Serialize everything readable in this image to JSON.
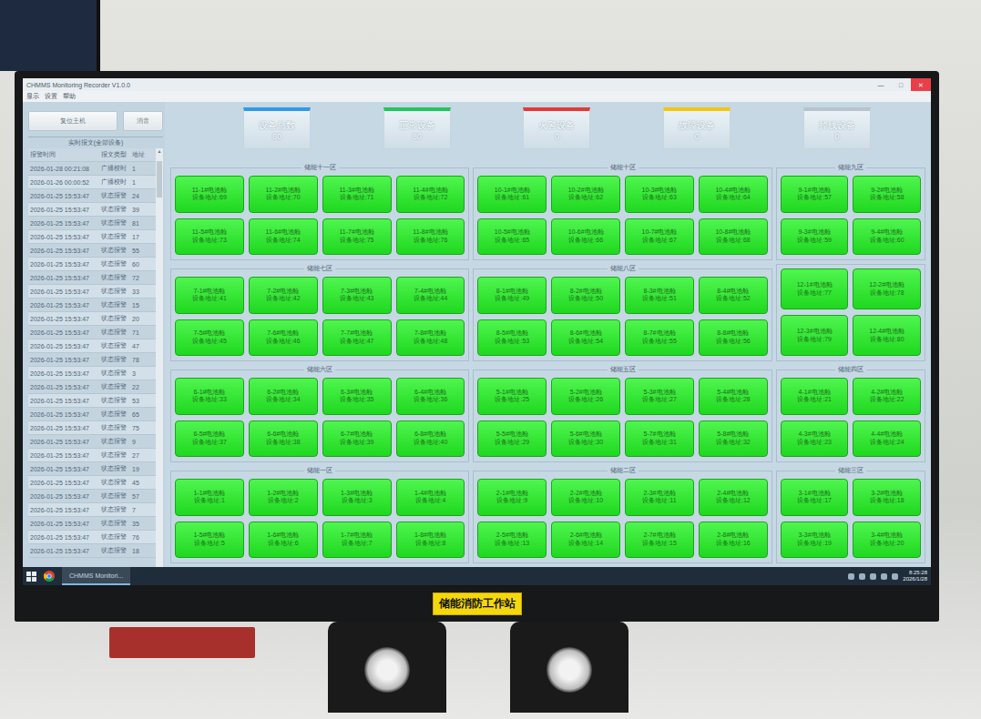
{
  "window": {
    "title": "CHMMS Monitoring Recorder V1.0.0",
    "controls": [
      "—",
      "□",
      "✕"
    ]
  },
  "menu": [
    "显示",
    "设置",
    "帮助"
  ],
  "buttons": [
    "复位主机",
    "消音"
  ],
  "log": {
    "title": "实时报文(全部设备)",
    "columns": [
      "报警时间",
      "报文类型",
      "地址"
    ],
    "rows": [
      [
        "2026-01-28 00:21:08",
        "广播校时",
        "1"
      ],
      [
        "2026-01-26 00:00:52",
        "广播校时",
        "1"
      ],
      [
        "2026-01-25 15:53:47",
        "状态报警",
        "24"
      ],
      [
        "2026-01-25 15:53:47",
        "状态报警",
        "39"
      ],
      [
        "2026-01-25 15:53:47",
        "状态报警",
        "81"
      ],
      [
        "2026-01-25 15:53:47",
        "状态报警",
        "17"
      ],
      [
        "2026-01-25 15:53:47",
        "状态报警",
        "55"
      ],
      [
        "2026-01-25 15:53:47",
        "状态报警",
        "60"
      ],
      [
        "2026-01-25 15:53:47",
        "状态报警",
        "72"
      ],
      [
        "2026-01-25 15:53:47",
        "状态报警",
        "33"
      ],
      [
        "2026-01-25 15:53:47",
        "状态报警",
        "15"
      ],
      [
        "2026-01-25 15:53:47",
        "状态报警",
        "20"
      ],
      [
        "2026-01-25 15:53:47",
        "状态报警",
        "71"
      ],
      [
        "2026-01-25 15:53:47",
        "状态报警",
        "47"
      ],
      [
        "2026-01-25 15:53:47",
        "状态报警",
        "78"
      ],
      [
        "2026-01-25 15:53:47",
        "状态报警",
        "3"
      ],
      [
        "2026-01-25 15:53:47",
        "状态报警",
        "22"
      ],
      [
        "2026-01-25 15:53:47",
        "状态报警",
        "53"
      ],
      [
        "2026-01-25 15:53:47",
        "状态报警",
        "65"
      ],
      [
        "2026-01-25 15:53:47",
        "状态报警",
        "75"
      ],
      [
        "2026-01-25 15:53:47",
        "状态报警",
        "9"
      ],
      [
        "2026-01-25 15:53:47",
        "状态报警",
        "27"
      ],
      [
        "2026-01-25 15:53:47",
        "状态报警",
        "19"
      ],
      [
        "2026-01-25 15:53:47",
        "状态报警",
        "45"
      ],
      [
        "2026-01-25 15:53:47",
        "状态报警",
        "57"
      ],
      [
        "2026-01-25 15:53:47",
        "状态报警",
        "7"
      ],
      [
        "2026-01-25 15:53:47",
        "状态报警",
        "35"
      ],
      [
        "2026-01-25 15:53:47",
        "状态报警",
        "76"
      ],
      [
        "2026-01-25 15:53:47",
        "状态报警",
        "18"
      ]
    ]
  },
  "stats": [
    {
      "label": "设备总数",
      "value": "80",
      "color": "#2f9be6"
    },
    {
      "label": "正常设备",
      "value": "80",
      "color": "#22c55e"
    },
    {
      "label": "火警设备",
      "value": "0",
      "color": "#e53935"
    },
    {
      "label": "故障设备",
      "value": "0",
      "color": "#f2c80f"
    },
    {
      "label": "掉线设备",
      "value": "0",
      "color": "#b9c3cc"
    }
  ],
  "zones": [
    {
      "label": "储能十一区",
      "cards": [
        {
          "name": "11-1#电池舱",
          "address": "设备地址:69",
          "status": "normal"
        },
        {
          "name": "11-2#电池舱",
          "address": "设备地址:70",
          "status": "normal"
        },
        {
          "name": "11-3#电池舱",
          "address": "设备地址:71",
          "status": "normal"
        },
        {
          "name": "11-4#电池舱",
          "address": "设备地址:72",
          "status": "normal"
        },
        {
          "name": "11-5#电池舱",
          "address": "设备地址:73",
          "status": "normal"
        },
        {
          "name": "11-6#电池舱",
          "address": "设备地址:74",
          "status": "normal"
        },
        {
          "name": "11-7#电池舱",
          "address": "设备地址:75",
          "status": "normal"
        },
        {
          "name": "11-8#电池舱",
          "address": "设备地址:76",
          "status": "normal"
        }
      ]
    },
    {
      "label": "储能十区",
      "cards": [
        {
          "name": "10-1#电池舱",
          "address": "设备地址:61",
          "status": "normal"
        },
        {
          "name": "10-2#电池舱",
          "address": "设备地址:62",
          "status": "normal"
        },
        {
          "name": "10-3#电池舱",
          "address": "设备地址:63",
          "status": "normal"
        },
        {
          "name": "10-4#电池舱",
          "address": "设备地址:64",
          "status": "normal"
        },
        {
          "name": "10-5#电池舱",
          "address": "设备地址:65",
          "status": "normal"
        },
        {
          "name": "10-6#电池舱",
          "address": "设备地址:66",
          "status": "normal"
        },
        {
          "name": "10-7#电池舱",
          "address": "设备地址:67",
          "status": "normal"
        },
        {
          "name": "10-8#电池舱",
          "address": "设备地址:68",
          "status": "normal"
        }
      ]
    },
    {
      "label": "储能九区",
      "cards": [
        {
          "name": "9-1#电池舱",
          "address": "设备地址:57",
          "status": "normal"
        },
        {
          "name": "9-2#电池舱",
          "address": "设备地址:58",
          "status": "normal"
        },
        {
          "name": "9-3#电池舱",
          "address": "设备地址:59",
          "status": "normal"
        },
        {
          "name": "9-4#电池舱",
          "address": "设备地址:60",
          "status": "normal"
        }
      ]
    },
    {
      "label": "储能七区",
      "cards": [
        {
          "name": "7-1#电池舱",
          "address": "设备地址:41",
          "status": "normal"
        },
        {
          "name": "7-2#电池舱",
          "address": "设备地址:42",
          "status": "normal"
        },
        {
          "name": "7-3#电池舱",
          "address": "设备地址:43",
          "status": "normal"
        },
        {
          "name": "7-4#电池舱",
          "address": "设备地址:44",
          "status": "normal"
        },
        {
          "name": "7-5#电池舱",
          "address": "设备地址:45",
          "status": "normal"
        },
        {
          "name": "7-6#电池舱",
          "address": "设备地址:46",
          "status": "normal"
        },
        {
          "name": "7-7#电池舱",
          "address": "设备地址:47",
          "status": "normal"
        },
        {
          "name": "7-8#电池舱",
          "address": "设备地址:48",
          "status": "normal"
        }
      ]
    },
    {
      "label": "储能八区",
      "cards": [
        {
          "name": "8-1#电池舱",
          "address": "设备地址:49",
          "status": "normal"
        },
        {
          "name": "8-2#电池舱",
          "address": "设备地址:50",
          "status": "normal"
        },
        {
          "name": "8-3#电池舱",
          "address": "设备地址:51",
          "status": "normal"
        },
        {
          "name": "8-4#电池舱",
          "address": "设备地址:52",
          "status": "normal"
        },
        {
          "name": "8-5#电池舱",
          "address": "设备地址:53",
          "status": "normal"
        },
        {
          "name": "8-6#电池舱",
          "address": "设备地址:54",
          "status": "normal"
        },
        {
          "name": "8-7#电池舱",
          "address": "设备地址:55",
          "status": "normal"
        },
        {
          "name": "8-8#电池舱",
          "address": "设备地址:56",
          "status": "normal"
        }
      ]
    },
    {
      "label": "",
      "cards": [
        {
          "name": "12-1#电池舱",
          "address": "设备地址:77",
          "status": "normal"
        },
        {
          "name": "12-2#电池舱",
          "address": "设备地址:78",
          "status": "normal"
        },
        {
          "name": "12-3#电池舱",
          "address": "设备地址:79",
          "status": "normal"
        },
        {
          "name": "12-4#电池舱",
          "address": "设备地址:80",
          "status": "normal"
        }
      ]
    },
    {
      "label": "储能六区",
      "cards": [
        {
          "name": "6-1#电池舱",
          "address": "设备地址:33",
          "status": "normal"
        },
        {
          "name": "6-2#电池舱",
          "address": "设备地址:34",
          "status": "normal"
        },
        {
          "name": "6-3#电池舱",
          "address": "设备地址:35",
          "status": "normal"
        },
        {
          "name": "6-4#电池舱",
          "address": "设备地址:36",
          "status": "normal"
        },
        {
          "name": "6-5#电池舱",
          "address": "设备地址:37",
          "status": "normal"
        },
        {
          "name": "6-6#电池舱",
          "address": "设备地址:38",
          "status": "normal"
        },
        {
          "name": "6-7#电池舱",
          "address": "设备地址:39",
          "status": "normal"
        },
        {
          "name": "6-8#电池舱",
          "address": "设备地址:40",
          "status": "normal"
        }
      ]
    },
    {
      "label": "储能五区",
      "cards": [
        {
          "name": "5-1#电池舱",
          "address": "设备地址:25",
          "status": "normal"
        },
        {
          "name": "5-2#电池舱",
          "address": "设备地址:26",
          "status": "normal"
        },
        {
          "name": "5-3#电池舱",
          "address": "设备地址:27",
          "status": "normal"
        },
        {
          "name": "5-4#电池舱",
          "address": "设备地址:28",
          "status": "normal"
        },
        {
          "name": "5-5#电池舱",
          "address": "设备地址:29",
          "status": "normal"
        },
        {
          "name": "5-6#电池舱",
          "address": "设备地址:30",
          "status": "normal"
        },
        {
          "name": "5-7#电池舱",
          "address": "设备地址:31",
          "status": "normal"
        },
        {
          "name": "5-8#电池舱",
          "address": "设备地址:32",
          "status": "normal"
        }
      ]
    },
    {
      "label": "储能四区",
      "cards": [
        {
          "name": "4-1#电池舱",
          "address": "设备地址:21",
          "status": "normal"
        },
        {
          "name": "4-2#电池舱",
          "address": "设备地址:22",
          "status": "normal"
        },
        {
          "name": "4-3#电池舱",
          "address": "设备地址:23",
          "status": "normal"
        },
        {
          "name": "4-4#电池舱",
          "address": "设备地址:24",
          "status": "normal"
        }
      ]
    },
    {
      "label": "储能一区",
      "cards": [
        {
          "name": "1-1#电池舱",
          "address": "设备地址:1",
          "status": "normal"
        },
        {
          "name": "1-2#电池舱",
          "address": "设备地址:2",
          "status": "normal"
        },
        {
          "name": "1-3#电池舱",
          "address": "设备地址:3",
          "status": "normal"
        },
        {
          "name": "1-4#电池舱",
          "address": "设备地址:4",
          "status": "normal"
        },
        {
          "name": "1-5#电池舱",
          "address": "设备地址:5",
          "status": "normal"
        },
        {
          "name": "1-6#电池舱",
          "address": "设备地址:6",
          "status": "normal"
        },
        {
          "name": "1-7#电池舱",
          "address": "设备地址:7",
          "status": "normal"
        },
        {
          "name": "1-8#电池舱",
          "address": "设备地址:8",
          "status": "normal"
        }
      ]
    },
    {
      "label": "储能二区",
      "cards": [
        {
          "name": "2-1#电池舱",
          "address": "设备地址:9",
          "status": "normal"
        },
        {
          "name": "2-2#电池舱",
          "address": "设备地址:10",
          "status": "normal"
        },
        {
          "name": "2-3#电池舱",
          "address": "设备地址:11",
          "status": "normal"
        },
        {
          "name": "2-4#电池舱",
          "address": "设备地址:12",
          "status": "normal"
        },
        {
          "name": "2-5#电池舱",
          "address": "设备地址:13",
          "status": "normal"
        },
        {
          "name": "2-6#电池舱",
          "address": "设备地址:14",
          "status": "normal"
        },
        {
          "name": "2-7#电池舱",
          "address": "设备地址:15",
          "status": "normal"
        },
        {
          "name": "2-8#电池舱",
          "address": "设备地址:16",
          "status": "normal"
        }
      ]
    },
    {
      "label": "储能三区",
      "cards": [
        {
          "name": "3-1#电池舱",
          "address": "设备地址:17",
          "status": "normal"
        },
        {
          "name": "3-2#电池舱",
          "address": "设备地址:18",
          "status": "normal"
        },
        {
          "name": "3-3#电池舱",
          "address": "设备地址:19",
          "status": "normal"
        },
        {
          "name": "3-4#电池舱",
          "address": "设备地址:20",
          "status": "normal"
        }
      ]
    }
  ],
  "taskbar": {
    "app": "CHMMS Monitori...",
    "time": "8:25:28",
    "date": "2026/1/28"
  },
  "monitor": {
    "label": "储能消防工作站"
  }
}
